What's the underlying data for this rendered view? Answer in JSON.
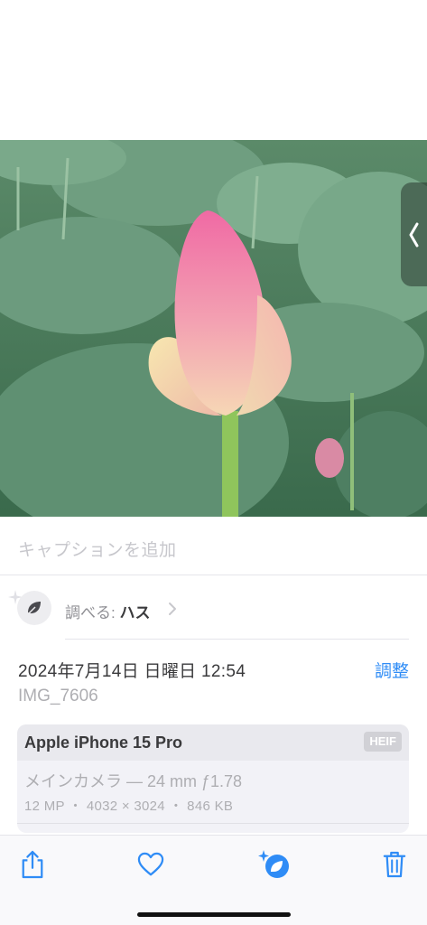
{
  "photo": {
    "alt": "蓮のつぼみ"
  },
  "caption": {
    "placeholder": "キャプションを追加"
  },
  "lookup": {
    "prefix": "調べる:",
    "subject": "ハス"
  },
  "meta": {
    "datetime": "2024年7月14日 日曜日 12:54",
    "adjust_label": "調整",
    "filename": "IMG_7606"
  },
  "camera": {
    "device": "Apple iPhone 15 Pro",
    "format_badge": "HEIF",
    "lens": "メインカメラ — 24 mm ƒ1.78",
    "specs": "12 MP ・ 4032 × 3024 ・ 846 KB"
  },
  "toolbar": {
    "icons": [
      "share-icon",
      "heart-icon",
      "visual-lookup-icon",
      "trash-icon"
    ]
  },
  "colors": {
    "accent": "#2f8cf6",
    "placeholder": "#c7c7cc"
  }
}
